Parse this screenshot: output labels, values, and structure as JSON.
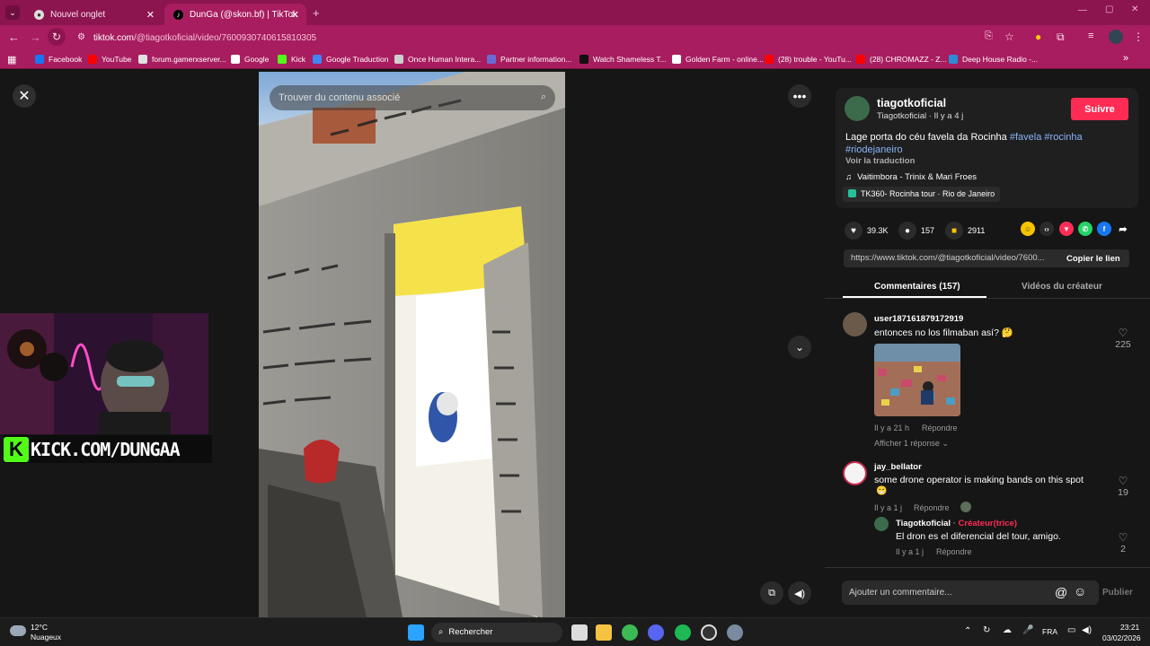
{
  "browser": {
    "tabs": [
      {
        "title": "Nouvel onglet",
        "close": "✕"
      },
      {
        "title": "DunGa (@skon.bf) | TikTok",
        "close": "✕"
      }
    ],
    "new_tab": "+",
    "url_host": "tiktok.com",
    "url_path": "/@tiagotkoficial/video/7600930740615810305",
    "bookmarks": [
      {
        "label": "Facebook",
        "color": "#1877f2"
      },
      {
        "label": "YouTube",
        "color": "#ff0000"
      },
      {
        "label": "forum.gamerxserver...",
        "color": "#e0e0e0"
      },
      {
        "label": "Google",
        "color": "#ffffff"
      },
      {
        "label": "Kick",
        "color": "#53fc18"
      },
      {
        "label": "Google Traduction",
        "color": "#4285f4"
      },
      {
        "label": "Once Human Intera...",
        "color": "#cfcfcf"
      },
      {
        "label": "Partner information...",
        "color": "#6b6bd6"
      },
      {
        "label": "Watch Shameless T...",
        "color": "#111111"
      },
      {
        "label": "Golden Farm - online...",
        "color": "#ffffff"
      },
      {
        "label": "(28) trouble - YouTu...",
        "color": "#ff0000"
      },
      {
        "label": "(28) CHROMAZZ - Z...",
        "color": "#ff0000"
      },
      {
        "label": "Deep House Radio -...",
        "color": "#2d8bd6"
      }
    ]
  },
  "video": {
    "search_placeholder": "Trouver du contenu associé"
  },
  "overlay": {
    "kick_text": "KICK.COM/DUNGAA",
    "kick_logo": "K"
  },
  "author": {
    "username": "tiagotkoficial",
    "subline": "Tiagotkoficial · Il y a 4 j",
    "follow": "Suivre",
    "description": "Lage porta do céu favela da Rocinha",
    "hashtags": [
      "#favela",
      "#rocinha",
      "#riodejaneiro"
    ],
    "see_translation": "Voir la traduction",
    "music": "Vaitimbora - Trinix & Mari Froes",
    "location": "TK360- Rocinha tour · Rio de Janeiro"
  },
  "stats": {
    "likes": "39.3K",
    "comments": "157",
    "saves": "2911"
  },
  "link": {
    "url": "https://www.tiktok.com/@tiagotkoficial/video/7600...",
    "copy": "Copier le lien"
  },
  "panel_tabs": {
    "comments": "Commentaires (157)",
    "creator_videos": "Vidéos du créateur"
  },
  "comments": [
    {
      "user": "user187161879172919",
      "text": "entonces no los filmaban así? 🤔",
      "time": "Il y a 21 h",
      "reply": "Répondre",
      "likes": "225",
      "more": "Afficher 1 réponse"
    },
    {
      "user": "jay_bellator",
      "text": "some drone operator is making bands on this spot",
      "time": "Il y a 1 j",
      "reply": "Répondre",
      "likes": "19"
    },
    {
      "user": "Tiagotkoficial",
      "badge": "Créateur(trice)",
      "text": "El dron es el diferencial del tour, amigo.",
      "time": "Il y a 1 j",
      "reply": "Répondre",
      "likes": "2"
    }
  ],
  "comment_box": {
    "placeholder": "Ajouter un commentaire...",
    "publish": "Publier"
  },
  "taskbar": {
    "temp": "12°C",
    "weather": "Nuageux",
    "search": "Rechercher",
    "lang": "FRA",
    "time": "23:21",
    "date": "03/02/2026"
  }
}
